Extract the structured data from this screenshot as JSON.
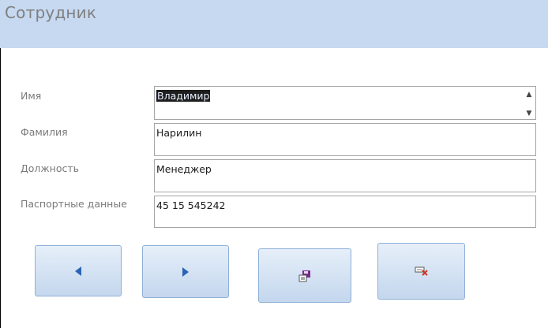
{
  "form": {
    "title": "Сотрудник"
  },
  "fields": [
    {
      "label": "Имя",
      "value": "Владимир"
    },
    {
      "label": "Фамилия",
      "value": "Нарилин"
    },
    {
      "label": "Должность",
      "value": "Менеджер"
    },
    {
      "label": "Паспортные данные",
      "value": "45 15 545242"
    }
  ],
  "buttons": {
    "previous": {
      "icon": "arrow-left-icon"
    },
    "next": {
      "icon": "arrow-right-icon"
    },
    "save": {
      "icon": "save-record-icon"
    },
    "delete": {
      "icon": "delete-record-icon"
    }
  },
  "colors": {
    "header_bg": "#c6d9f1",
    "button_bg": "#d5e3f4",
    "arrow": "#2a64b4"
  }
}
